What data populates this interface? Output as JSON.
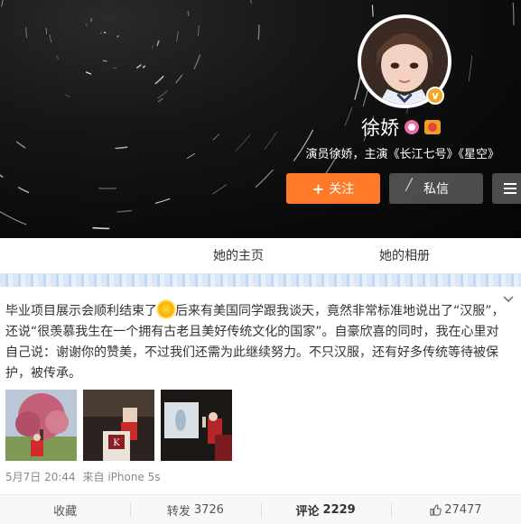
{
  "profile": {
    "name": "徐娇",
    "description": "演员徐娇，主演《长江七号》《星空》",
    "follow_plus": "+",
    "follow_label": "关注",
    "message_label": "私信",
    "verified_mark": "v"
  },
  "tabs": {
    "home": "她的主页",
    "album": "她的相册"
  },
  "post": {
    "text_part1": "毕业项目展示会顺利结束了",
    "text_part2": "后来有美国同学跟我谈天，竟然非常标准地说出了“汉服”，还说“很羡慕我生在一个拥有古老且美好传统文化的国家”。自豪欣喜的同时，我在心里对自己说：谢谢你的赞美，不过我们还需为此继续努力。不只汉服，还有好多传统等待被保护，被传承。",
    "time": "5月7日 20:44",
    "source": "来自 iPhone 5s"
  },
  "actions": {
    "favorite": "收藏",
    "repost_label": "转发",
    "repost_count": "3726",
    "comment_label": "评论",
    "comment_count": "2229",
    "like_count": "27477"
  },
  "colors": {
    "follow_button": "#ff7a28",
    "accent_orange": "#f5a623",
    "tab_strip": "#d9e7f7"
  },
  "icons": [
    "chevron-down-icon",
    "menu-icon",
    "female-icon",
    "vip-icon",
    "verified-icon",
    "sun-emoji-icon",
    "like-icon"
  ]
}
